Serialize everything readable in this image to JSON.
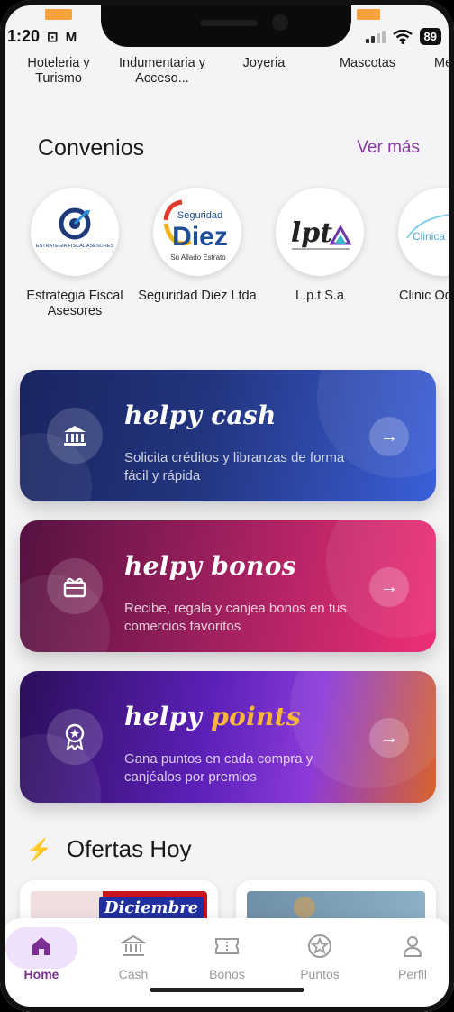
{
  "status_bar": {
    "time": "1:20",
    "icons_text": "⊡ M",
    "battery": "89"
  },
  "categories": [
    "Hoteleria y Turismo",
    "Indumentaria y Acceso...",
    "Joyeria",
    "Mascotas",
    "Me"
  ],
  "convenios": {
    "title": "Convenios",
    "see_more": "Ver más",
    "items": [
      {
        "name": "Estrategia Fiscal Asesores",
        "logo_text": "ESTRATEGIA FISCAL ASESORES"
      },
      {
        "name": "Seguridad Diez Ltda",
        "logo_text": "Seguridad Diez",
        "logo_sub": "Su Allado Estrato"
      },
      {
        "name": "L.p.t  S.a",
        "logo_text": "lpt"
      },
      {
        "name": "Clinic Odontolo",
        "logo_text": "Clinica M"
      }
    ]
  },
  "cards": [
    {
      "title": "helpy cash",
      "desc": "Solicita créditos y libranzas de forma fácil y rápida"
    },
    {
      "title": "helpy bonos",
      "desc": "Recibe, regala y canjea bonos en tus comercios favoritos"
    },
    {
      "title_main": "helpy",
      "title_accent": "points",
      "desc": "Gana puntos en cada compra y canjéalos por premios"
    }
  ],
  "offers": {
    "title": "Ofertas Hoy",
    "first_card_text": "Diciembre"
  },
  "bottom_nav": [
    {
      "label": "Home",
      "icon": "home-icon",
      "active": true
    },
    {
      "label": "Cash",
      "icon": "bank-icon",
      "active": false
    },
    {
      "label": "Bonos",
      "icon": "ticket-icon",
      "active": false
    },
    {
      "label": "Puntos",
      "icon": "star-badge-icon",
      "active": false
    },
    {
      "label": "Perfil",
      "icon": "user-icon",
      "active": false
    }
  ],
  "colors": {
    "accent": "#7b2f93",
    "cash_gradient": [
      "#1b2a6b",
      "#3a5ed8"
    ],
    "bonos_gradient": [
      "#5a1447",
      "#ea2f78"
    ],
    "points_gradient": [
      "#2b0f5d",
      "#8b3ad8",
      "#d4622e"
    ]
  }
}
